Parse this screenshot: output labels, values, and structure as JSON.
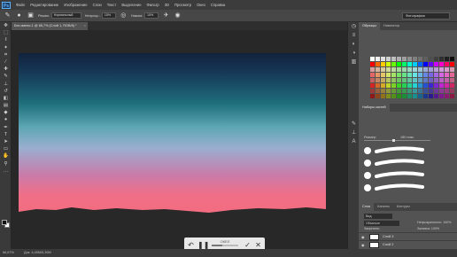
{
  "app": {
    "logo": "Ps",
    "menu": [
      "Файл",
      "Редактирование",
      "Изображение",
      "Слои",
      "Текст",
      "Выделение",
      "Фильтр",
      "3D",
      "Просмотр",
      "Окно",
      "Справка"
    ]
  },
  "options": {
    "mode_label": "Режим:",
    "mode_value": "Нормальный",
    "opacity_label": "Непрозр.:",
    "opacity_value": "15%",
    "flow_label": "Нажим:",
    "flow_value": "15%",
    "workspace": "Фотография"
  },
  "document": {
    "tab_title": "Без имени-1 @ 66,7% (Слой 1, RGB/8) *"
  },
  "status": {
    "zoom": "66,67%",
    "doc_info": "Док: 4,40M/5,39M"
  },
  "hud": {
    "title": "ОКЕЛ"
  },
  "panels": {
    "top_tabs": [
      "Образцы",
      "Навигатор"
    ],
    "brush_tabs": [
      "Наборы кистей"
    ],
    "brush_size_label": "Размер:",
    "brush_size_value": "180 пикс.",
    "brush_size_fraction": 0.45,
    "layer_tabs": [
      "Слои",
      "Каналы",
      "Контуры"
    ],
    "layer_filter": "Вид",
    "blend_mode": "Обычные",
    "opacity": "Непрозрачность: 100%",
    "lock": "Закрепить:",
    "fill": "Заливка: 100%",
    "layers": [
      {
        "name": "Слой 3",
        "selected": false
      },
      {
        "name": "Слой 2",
        "selected": false
      },
      {
        "name": "Слой 1",
        "selected": true
      },
      {
        "name": "Фон",
        "selected": false
      }
    ]
  },
  "colors": {
    "accent": "#5fb3ff",
    "panel_bg": "#535353",
    "app_bg": "#2b2b2b"
  }
}
